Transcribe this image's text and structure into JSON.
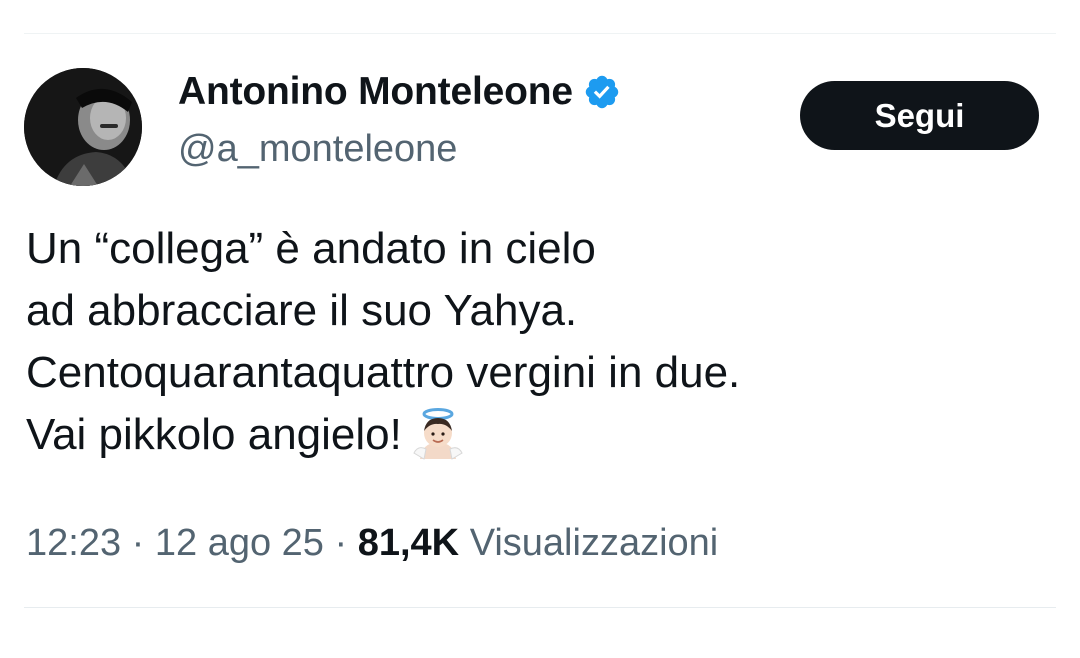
{
  "author": {
    "display_name": "Antonino Monteleone",
    "handle": "@a_monteleone",
    "verified_icon": "verified-badge-icon",
    "avatar": "profile-photo"
  },
  "actions": {
    "follow_label": "Segui"
  },
  "tweet": {
    "lines": [
      "Un “collega” è andato in cielo",
      "ad abbracciare il suo Yahya.",
      "Centoquarantaquattro vergini in due.",
      "Vai pikkolo angielo!"
    ],
    "emoji": "baby-angel-emoji"
  },
  "meta": {
    "time": "12:23",
    "separator": " · ",
    "date": "12 ago 25",
    "views_count": "81,4K",
    "views_label": "Visualizzazioni"
  },
  "colors": {
    "text_primary": "#0f1419",
    "text_secondary": "#536471",
    "verified_blue": "#1d9bf0",
    "button_bg": "#0f1419",
    "divider": "#eff3f4"
  }
}
